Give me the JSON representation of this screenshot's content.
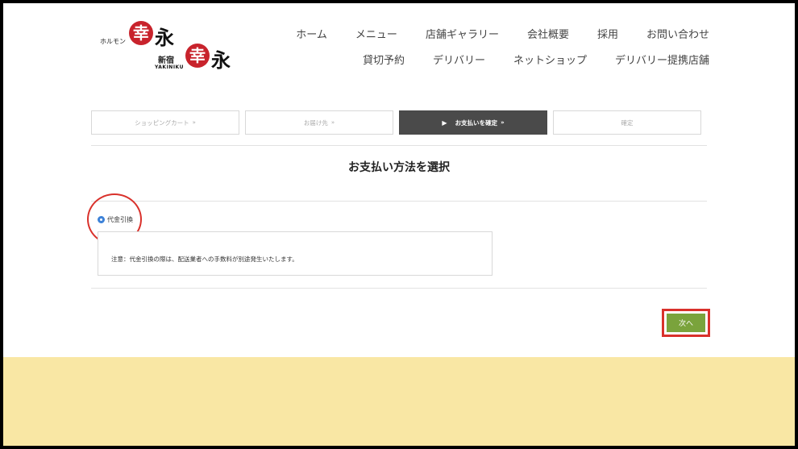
{
  "logo": {
    "prefix": "ホルモン",
    "mark1": "幸",
    "name1": "永",
    "location": "新宿",
    "subname": "YAKINIKU",
    "mark2": "幸",
    "name2": "永"
  },
  "nav": {
    "row1": [
      "ホーム",
      "メニュー",
      "店舗ギャラリー",
      "会社概要",
      "採用",
      "お問い合わせ"
    ],
    "row2": [
      "貸切予約",
      "デリバリー",
      "ネットショップ",
      "デリバリー提携店舗"
    ]
  },
  "steps": [
    {
      "label": "ショッピングカート",
      "suffix": "»"
    },
    {
      "label": "お届け先",
      "suffix": "»"
    },
    {
      "label": "お支払いを確定",
      "suffix": "»",
      "active": true
    },
    {
      "label": "確定",
      "suffix": ""
    }
  ],
  "page_title": "お支払い方法を選択",
  "payment": {
    "option_label": "代金引換",
    "selected": true,
    "note": "注意：代金引換の際は、配送業者への手数料が別途発生いたします。"
  },
  "next_button": "次へ",
  "colors": {
    "accent_red": "#d9312b",
    "next_green": "#7aa33c",
    "footer_yellow": "#f9e7a4",
    "active_step": "#4a4a4a",
    "radio_blue": "#3d82d8"
  }
}
